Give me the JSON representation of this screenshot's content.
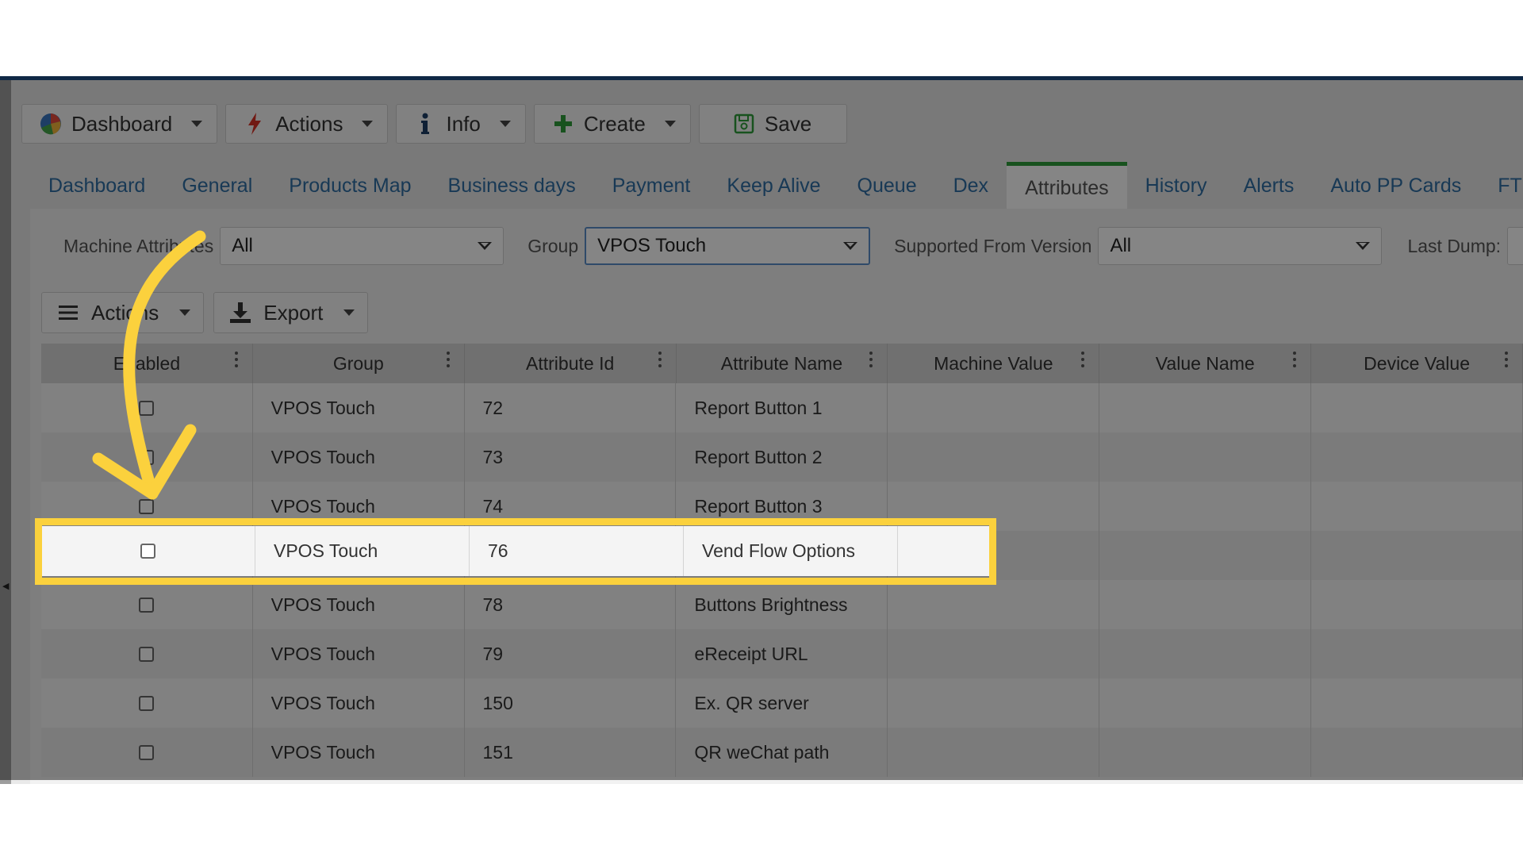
{
  "toolbar": {
    "dashboard_label": "Dashboard",
    "actions_label": "Actions",
    "info_label": "Info",
    "create_label": "Create",
    "save_label": "Save"
  },
  "tabs": [
    {
      "label": "Dashboard"
    },
    {
      "label": "General"
    },
    {
      "label": "Products Map"
    },
    {
      "label": "Business days"
    },
    {
      "label": "Payment"
    },
    {
      "label": "Keep Alive"
    },
    {
      "label": "Queue"
    },
    {
      "label": "Dex"
    },
    {
      "label": "Attributes",
      "active": true
    },
    {
      "label": "History"
    },
    {
      "label": "Alerts"
    },
    {
      "label": "Auto PP Cards"
    },
    {
      "label": "FTL"
    }
  ],
  "filters": {
    "machine_attributes_label": "Machine Attributes",
    "machine_attributes_value": "All",
    "group_label": "Group",
    "group_value": "VPOS Touch",
    "supported_from_version_label": "Supported From Version",
    "supported_from_version_value": "All",
    "last_dump_label": "Last Dump:"
  },
  "grid_toolbar": {
    "actions_label": "Actions",
    "export_label": "Export"
  },
  "grid": {
    "columns": [
      "Enabled",
      "Group",
      "Attribute Id",
      "Attribute Name",
      "Machine Value",
      "Value Name",
      "Device Value"
    ],
    "rows": [
      {
        "group": "VPOS Touch",
        "id": "72",
        "name": "Report Button 1"
      },
      {
        "group": "VPOS Touch",
        "id": "73",
        "name": "Report Button 2"
      },
      {
        "group": "VPOS Touch",
        "id": "74",
        "name": "Report Button 3"
      },
      {
        "group": "VPOS Touch",
        "id": "76",
        "name": "Vend Flow Options"
      },
      {
        "group": "VPOS Touch",
        "id": "78",
        "name": "Buttons Brightness"
      },
      {
        "group": "VPOS Touch",
        "id": "79",
        "name": "eReceipt URL"
      },
      {
        "group": "VPOS Touch",
        "id": "150",
        "name": "Ex. QR server"
      },
      {
        "group": "VPOS Touch",
        "id": "151",
        "name": "QR weChat path"
      }
    ]
  },
  "highlight": {
    "row_index": 3,
    "color": "#fbd13d"
  },
  "colors": {
    "accent_border": "#1d4d85",
    "active_tab": "#2f9e3b",
    "link": "#2e6da4"
  }
}
